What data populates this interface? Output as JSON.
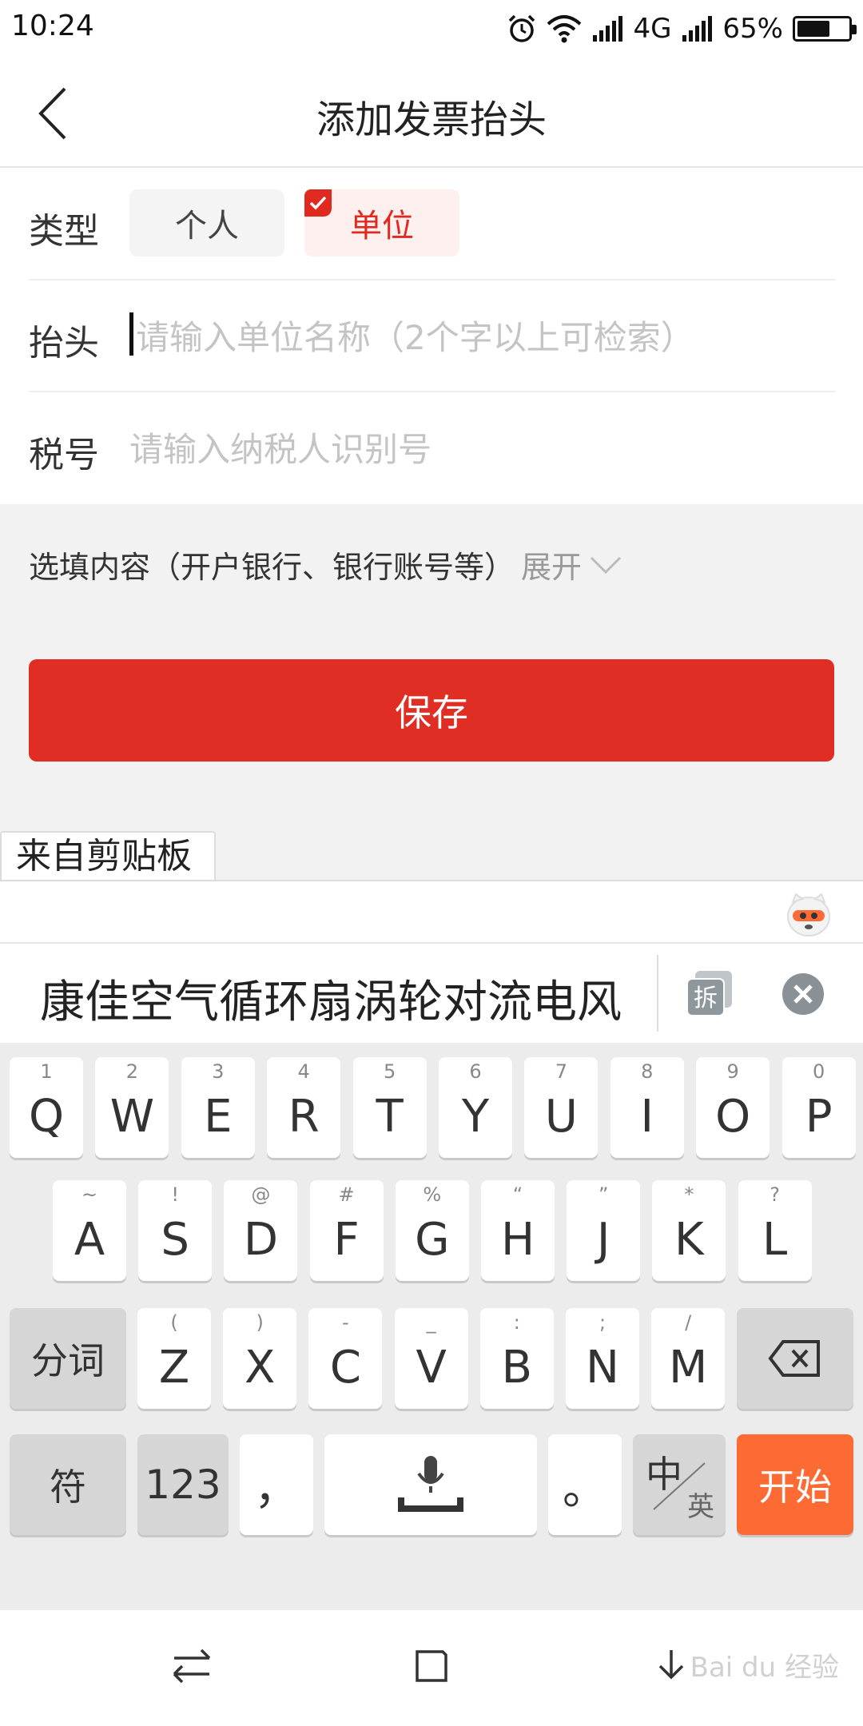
{
  "status_bar": {
    "time": "10:24",
    "network": "4G",
    "battery": "65%",
    "battery_level": 0.65
  },
  "header": {
    "title": "添加发票抬头",
    "back_icon": "chevron-left-icon"
  },
  "form": {
    "type_label": "类型",
    "type_options": [
      "个人",
      "单位"
    ],
    "selected_type": "单位",
    "title_label": "抬头",
    "title_placeholder": "请输入单位名称（2个字以上可检索）",
    "tax_label": "税号",
    "tax_placeholder": "请输入纳税人识别号"
  },
  "optional": {
    "label": "选填内容（开户银行、银行账号等）",
    "expand": "展开"
  },
  "save_button": "保存",
  "clipboard": {
    "tab_label": "来自剪贴板",
    "text": "康佳空气循环扇涡轮对流电风",
    "split_label": "拆"
  },
  "keyboard": {
    "row1": [
      {
        "hint": "1",
        "key": "Q"
      },
      {
        "hint": "2",
        "key": "W"
      },
      {
        "hint": "3",
        "key": "E"
      },
      {
        "hint": "4",
        "key": "R"
      },
      {
        "hint": "5",
        "key": "T"
      },
      {
        "hint": "6",
        "key": "Y"
      },
      {
        "hint": "7",
        "key": "U"
      },
      {
        "hint": "8",
        "key": "I"
      },
      {
        "hint": "9",
        "key": "O"
      },
      {
        "hint": "0",
        "key": "P"
      }
    ],
    "row2": [
      {
        "hint": "~",
        "key": "A"
      },
      {
        "hint": "!",
        "key": "S"
      },
      {
        "hint": "@",
        "key": "D"
      },
      {
        "hint": "#",
        "key": "F"
      },
      {
        "hint": "%",
        "key": "G"
      },
      {
        "hint": "“",
        "key": "H"
      },
      {
        "hint": "”",
        "key": "J"
      },
      {
        "hint": "*",
        "key": "K"
      },
      {
        "hint": "?",
        "key": "L"
      }
    ],
    "row3": [
      {
        "hint": "(",
        "key": "Z"
      },
      {
        "hint": ")",
        "key": "X"
      },
      {
        "hint": "-",
        "key": "C"
      },
      {
        "hint": "_",
        "key": "V"
      },
      {
        "hint": ":",
        "key": "B"
      },
      {
        "hint": ";",
        "key": "N"
      },
      {
        "hint": "/",
        "key": "M"
      }
    ],
    "fenci": "分词",
    "symbols": "符",
    "numbers": "123",
    "comma": "，",
    "period": "。",
    "lang_zh": "中",
    "lang_en": "英",
    "start": "开始"
  },
  "nav": {
    "watermark": "Bai du 经验"
  },
  "colors": {
    "accent": "#e02e24",
    "start_key": "#fe6a33"
  }
}
